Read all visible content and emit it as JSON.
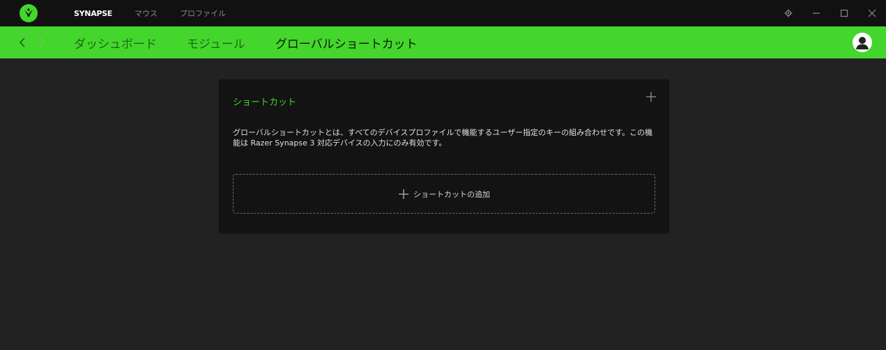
{
  "colors": {
    "accent": "#44d62c",
    "titlebar_bg": "#111111",
    "content_bg": "#222222",
    "panel_bg": "#131313"
  },
  "titlebar": {
    "logo_icon": "razer-snake-logo-icon",
    "tabs": [
      {
        "label": "SYNAPSE",
        "active": true
      },
      {
        "label": "マウス",
        "active": false
      },
      {
        "label": "プロファイル",
        "active": false
      }
    ],
    "controls": [
      "settings-gear-icon",
      "minimize-icon",
      "maximize-icon",
      "close-icon"
    ]
  },
  "navbar": {
    "back_icon": "chevron-left-icon",
    "forward_icon": "chevron-right-icon",
    "tabs": [
      {
        "label": "ダッシュボード",
        "active": false
      },
      {
        "label": "モジュール",
        "active": false
      },
      {
        "label": "グローバルショートカット",
        "active": true
      }
    ],
    "avatar_icon": "user-avatar-icon"
  },
  "panel": {
    "title": "ショートカット",
    "add_icon": "plus-icon",
    "description": "グローバルショートカットとは、すべてのデバイスプロファイルで機能するユーザー指定のキーの組み合わせです。この機能は Razer Synapse 3 対応デバイスの入力にのみ有効です。",
    "add_button_label": "ショートカットの追加"
  }
}
